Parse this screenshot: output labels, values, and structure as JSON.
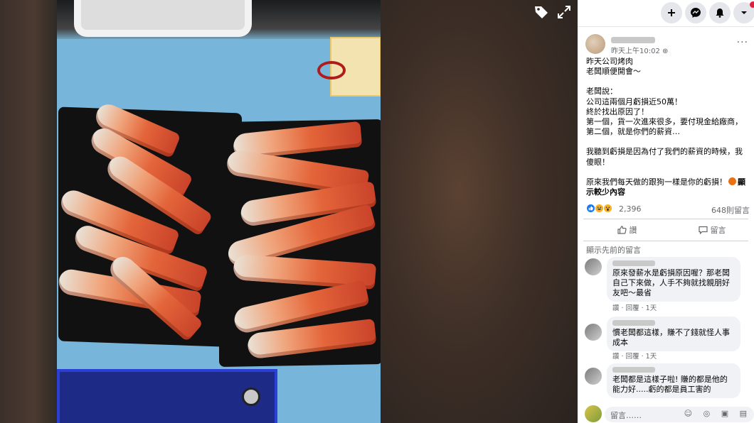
{
  "viewer": {
    "tag_icon": "tag-icon",
    "expand_icon": "expand-icon"
  },
  "topbar": {
    "create_icon": "plus-icon",
    "messenger_icon": "messenger-icon",
    "notifications_icon": "bell-icon",
    "account_icon": "chevron-down-icon"
  },
  "post": {
    "timestamp": "昨天上午10:02",
    "privacy_symbol": "⊕",
    "options_symbol": "···",
    "text_p1_l1": "昨天公司烤肉",
    "text_p1_l2": "老闆順便開會～",
    "text_p2_l1": "老闆說：",
    "text_p2_l2": "公司這兩個月虧損近50萬！",
    "text_p2_l3": "終於找出原因了！",
    "text_p2_l4": "第一個，貨一次進來很多，要付現金給廠商，",
    "text_p2_l5": "第二個，就是你們的薪資…",
    "text_p3": "我聽到虧損是因為付了我們的薪資的時候，我傻眼！",
    "text_p4": "原來我們每天做的跟狗一樣是你的虧損！",
    "see_more": "顯示較少內容",
    "reaction_count": "2,396",
    "comment_count": "648則留言",
    "like_label": "讚",
    "comment_label": "留言",
    "view_previous": "顯示先前的留言"
  },
  "comments": [
    {
      "text": "原來發薪水是虧損原因喔？那老闆自己下來做，人手不夠就找親朋好友吧～最省",
      "like": "讚",
      "reply": "回覆",
      "time": "1天"
    },
    {
      "text": "慣老闆都這樣，賺不了錢就怪人事成本",
      "like": "讚",
      "reply": "回覆",
      "time": "1天"
    },
    {
      "text": "老闆都是這樣子啦! 賺的都是他的能力好.....虧的都是員工害的",
      "like": "",
      "reply": "",
      "time": ""
    }
  ],
  "composer": {
    "placeholder": "留言……",
    "icons": "☺ ◎ ▣ ▤"
  },
  "colors": {
    "panel_bg": "#ffffff",
    "bubble_bg": "#f0f2f5",
    "meta_text": "#65676b",
    "like_blue": "#1877f2",
    "love_red": "#f33e58",
    "haha_yellow": "#f7b125"
  }
}
